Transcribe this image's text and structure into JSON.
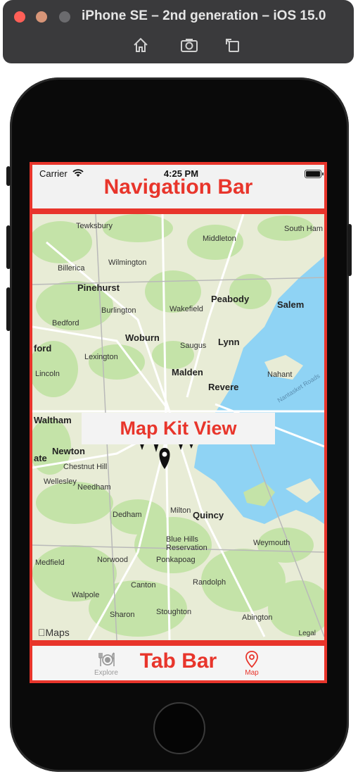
{
  "simulator": {
    "title": "iPhone SE – 2nd generation – iOS 15.0",
    "toolbar": [
      "home-icon",
      "screenshot-icon",
      "rotate-icon"
    ]
  },
  "status_bar": {
    "carrier": "Carrier",
    "time": "4:25 PM"
  },
  "navigation_bar": {
    "label": "Navigation Bar"
  },
  "map": {
    "label": "Map Kit View",
    "attribution": "Maps",
    "legal": "Legal",
    "towns": {
      "tewksbury": "Tewksbury",
      "middleton": "Middleton",
      "south_ham": "South Ham",
      "billerica": "Billerica",
      "wilmington": "Wilmington",
      "pinehurst": "Pinehurst",
      "peabody": "Peabody",
      "salem": "Salem",
      "burlington": "Burlington",
      "wakefield": "Wakefield",
      "bedford": "Bedford",
      "woburn": "Woburn",
      "saugus": "Saugus",
      "lynn": "Lynn",
      "ford": "ford",
      "lexington": "Lexington",
      "nahant": "Nahant",
      "lincoln": "Lincoln",
      "malden": "Malden",
      "revere": "Revere",
      "waltham": "Waltham",
      "ate": "ate",
      "newton": "Newton",
      "chestnut_hill": "Chestnut Hill",
      "wellesley": "Wellesley",
      "needham": "Needham",
      "dedham": "Dedham",
      "milton": "Milton",
      "quincy": "Quincy",
      "weymouth": "Weymouth",
      "blue_hills": "Blue Hills\nReservation",
      "medfield": "Medfield",
      "norwood": "Norwood",
      "ponkapoag": "Ponkapoag",
      "canton": "Canton",
      "randolph": "Randolph",
      "walpole": "Walpole",
      "sharon": "Sharon",
      "stoughton": "Stoughton",
      "abington": "Abington",
      "nantasket": "Nantasket Roads"
    }
  },
  "tab_bar": {
    "label": "Tab Bar",
    "tabs": [
      {
        "label": "Explore",
        "icon": "plate-utensils-icon",
        "selected": false
      },
      {
        "label": "Map",
        "icon": "map-pin-icon",
        "selected": true
      }
    ]
  },
  "colors": {
    "annotation_red": "#e8352b",
    "tab_selected": "#e8352b",
    "tab_unselected": "#9a9a9a",
    "water": "#8fd3f4",
    "park": "#c4e3a8"
  }
}
